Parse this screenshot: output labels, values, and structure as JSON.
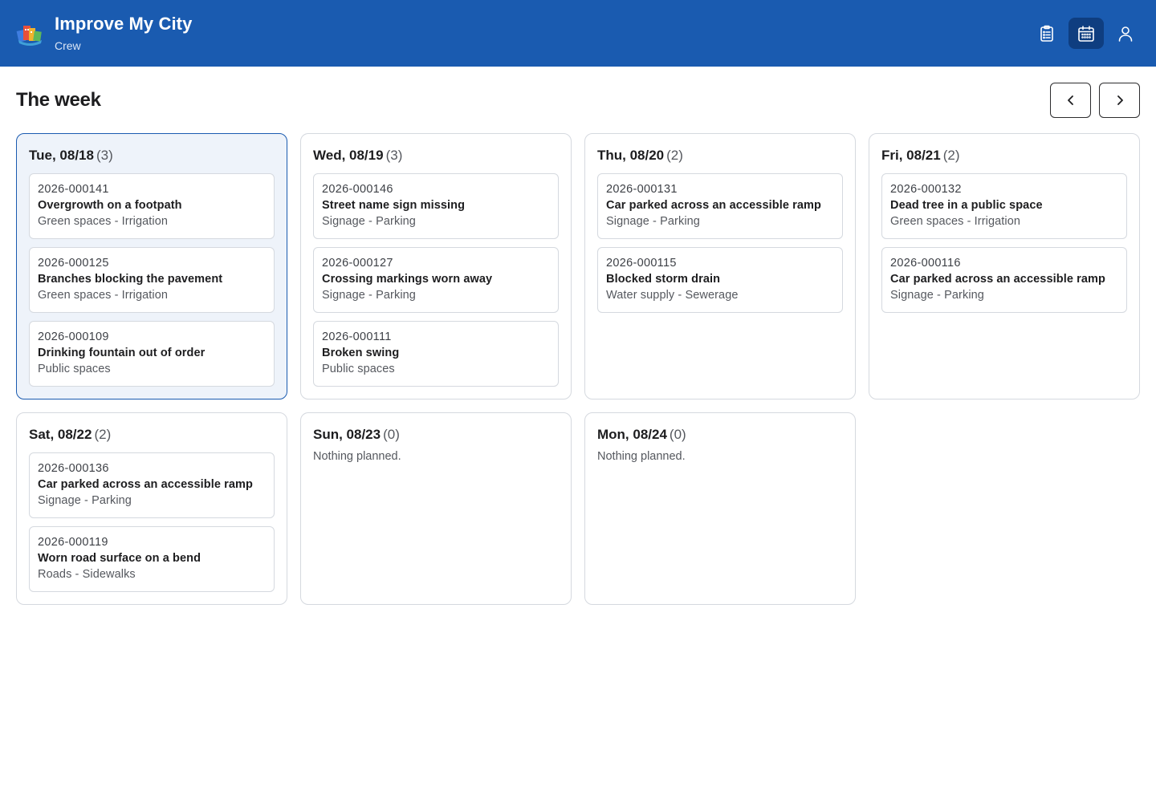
{
  "header": {
    "title": "Improve My City",
    "subtitle": "Crew",
    "nav": [
      {
        "icon": "clipboard-icon",
        "active": false
      },
      {
        "icon": "calendar-icon",
        "active": true
      },
      {
        "icon": "user-icon",
        "active": false
      }
    ]
  },
  "page": {
    "title": "The week"
  },
  "days": [
    {
      "name": "Tue, 08/18",
      "count": "(3)",
      "today": true,
      "tasks": [
        {
          "id": "2026-000141",
          "title": "Overgrowth on a footpath",
          "category": "Green spaces - Irrigation"
        },
        {
          "id": "2026-000125",
          "title": "Branches blocking the pavement",
          "category": "Green spaces - Irrigation"
        },
        {
          "id": "2026-000109",
          "title": "Drinking fountain out of order",
          "category": "Public spaces"
        }
      ]
    },
    {
      "name": "Wed, 08/19",
      "count": "(3)",
      "today": false,
      "tasks": [
        {
          "id": "2026-000146",
          "title": "Street name sign missing",
          "category": "Signage - Parking"
        },
        {
          "id": "2026-000127",
          "title": "Crossing markings worn away",
          "category": "Signage - Parking"
        },
        {
          "id": "2026-000111",
          "title": "Broken swing",
          "category": "Public spaces"
        }
      ]
    },
    {
      "name": "Thu, 08/20",
      "count": "(2)",
      "today": false,
      "tasks": [
        {
          "id": "2026-000131",
          "title": "Car parked across an accessible ramp",
          "category": "Signage - Parking"
        },
        {
          "id": "2026-000115",
          "title": "Blocked storm drain",
          "category": "Water supply - Sewerage"
        }
      ]
    },
    {
      "name": "Fri, 08/21",
      "count": "(2)",
      "today": false,
      "tasks": [
        {
          "id": "2026-000132",
          "title": "Dead tree in a public space",
          "category": "Green spaces - Irrigation"
        },
        {
          "id": "2026-000116",
          "title": "Car parked across an accessible ramp",
          "category": "Signage - Parking"
        }
      ]
    },
    {
      "name": "Sat, 08/22",
      "count": "(2)",
      "today": false,
      "tasks": [
        {
          "id": "2026-000136",
          "title": "Car parked across an accessible ramp",
          "category": "Signage - Parking"
        },
        {
          "id": "2026-000119",
          "title": "Worn road surface on a bend",
          "category": "Roads - Sidewalks"
        }
      ]
    },
    {
      "name": "Sun, 08/23",
      "count": "(0)",
      "today": false,
      "empty": "Nothing planned.",
      "tasks": []
    },
    {
      "name": "Mon, 08/24",
      "count": "(0)",
      "today": false,
      "empty": "Nothing planned.",
      "tasks": []
    }
  ],
  "colors": {
    "header": "#1a5bb0",
    "active_nav": "#0f3e80",
    "today_border": "#1a5bb0",
    "today_bg": "#eef3fa"
  }
}
